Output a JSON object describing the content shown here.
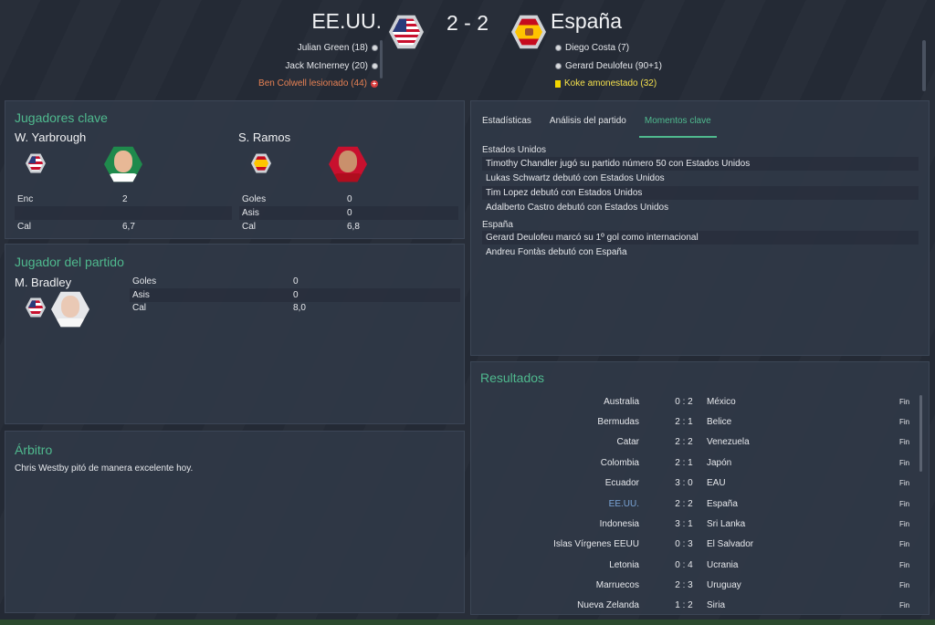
{
  "match": {
    "home_team": "EE.UU.",
    "away_team": "España",
    "score": "2 - 2",
    "home_crest_icon": "usa-crest-icon",
    "away_crest_icon": "spain-crest-icon",
    "home_events": [
      {
        "text": "Julian Green (18)",
        "type": "goal",
        "icon": "ball-icon"
      },
      {
        "text": "Jack McInerney (20)",
        "type": "goal",
        "icon": "ball-icon"
      },
      {
        "text": "Ben Colwell lesionado (44)",
        "type": "injury",
        "icon": "injury-cross-icon"
      }
    ],
    "away_events": [
      {
        "text": "Diego Costa (7)",
        "type": "goal",
        "icon": "ball-icon"
      },
      {
        "text": "Gerard Deulofeu (90+1)",
        "type": "goal",
        "icon": "ball-icon"
      },
      {
        "text": "Koke amonestado (32)",
        "type": "booking",
        "icon": "yellow-card-icon"
      }
    ]
  },
  "key_players": {
    "title": "Jugadores clave",
    "home": {
      "name": "W. Yarbrough",
      "stats": [
        {
          "label": "Enc",
          "value": "2"
        },
        {
          "label": "",
          "value": ""
        },
        {
          "label": "Cal",
          "value": "6,7"
        }
      ]
    },
    "away": {
      "name": "S. Ramos",
      "stats": [
        {
          "label": "Goles",
          "value": "0"
        },
        {
          "label": "Asis",
          "value": "0"
        },
        {
          "label": "Cal",
          "value": "6,8"
        }
      ]
    }
  },
  "man_of_match": {
    "title": "Jugador del partido",
    "name": "M. Bradley",
    "stats": [
      {
        "label": "Goles",
        "value": "0"
      },
      {
        "label": "Asis",
        "value": "0"
      },
      {
        "label": "Cal",
        "value": "8,0"
      }
    ]
  },
  "referee": {
    "title": "Árbitro",
    "text": "Chris Westby pitó de manera excelente hoy."
  },
  "moments": {
    "tabs": [
      "Estadísticas",
      "Análisis del partido",
      "Momentos clave"
    ],
    "active_tab": "Momentos clave",
    "groups": [
      {
        "team": "Estados Unidos",
        "items": [
          "Timothy Chandler jugó su partido número 50 con Estados Unidos",
          "Lukas Schwartz debutó con Estados Unidos",
          "Tim Lopez debutó con Estados Unidos",
          "Adalberto Castro debutó con Estados Unidos"
        ]
      },
      {
        "team": "España",
        "items": [
          "Gerard Deulofeu marcó su 1º gol como internacional",
          "Andreu Fontàs debutó con España"
        ]
      }
    ]
  },
  "results": {
    "title": "Resultados",
    "rows": [
      {
        "home": "Australia",
        "score": "0 : 2",
        "away": "México",
        "status": "Fin"
      },
      {
        "home": "Bermudas",
        "score": "2 : 1",
        "away": "Belice",
        "status": "Fin"
      },
      {
        "home": "Catar",
        "score": "2 : 2",
        "away": "Venezuela",
        "status": "Fin"
      },
      {
        "home": "Colombia",
        "score": "2 : 1",
        "away": "Japón",
        "status": "Fin"
      },
      {
        "home": "Ecuador",
        "score": "3 : 0",
        "away": "EAU",
        "status": "Fin"
      },
      {
        "home": "EE.UU.",
        "score": "2 : 2",
        "away": "España",
        "status": "Fin",
        "highlight": true
      },
      {
        "home": "Indonesia",
        "score": "3 : 1",
        "away": "Sri Lanka",
        "status": "Fin"
      },
      {
        "home": "Islas Vírgenes EEUU",
        "score": "0 : 3",
        "away": "El Salvador",
        "status": "Fin"
      },
      {
        "home": "Letonia",
        "score": "0 : 4",
        "away": "Ucrania",
        "status": "Fin"
      },
      {
        "home": "Marruecos",
        "score": "2 : 3",
        "away": "Uruguay",
        "status": "Fin"
      },
      {
        "home": "Nueva Zelanda",
        "score": "1 : 2",
        "away": "Siria",
        "status": "Fin"
      }
    ]
  }
}
